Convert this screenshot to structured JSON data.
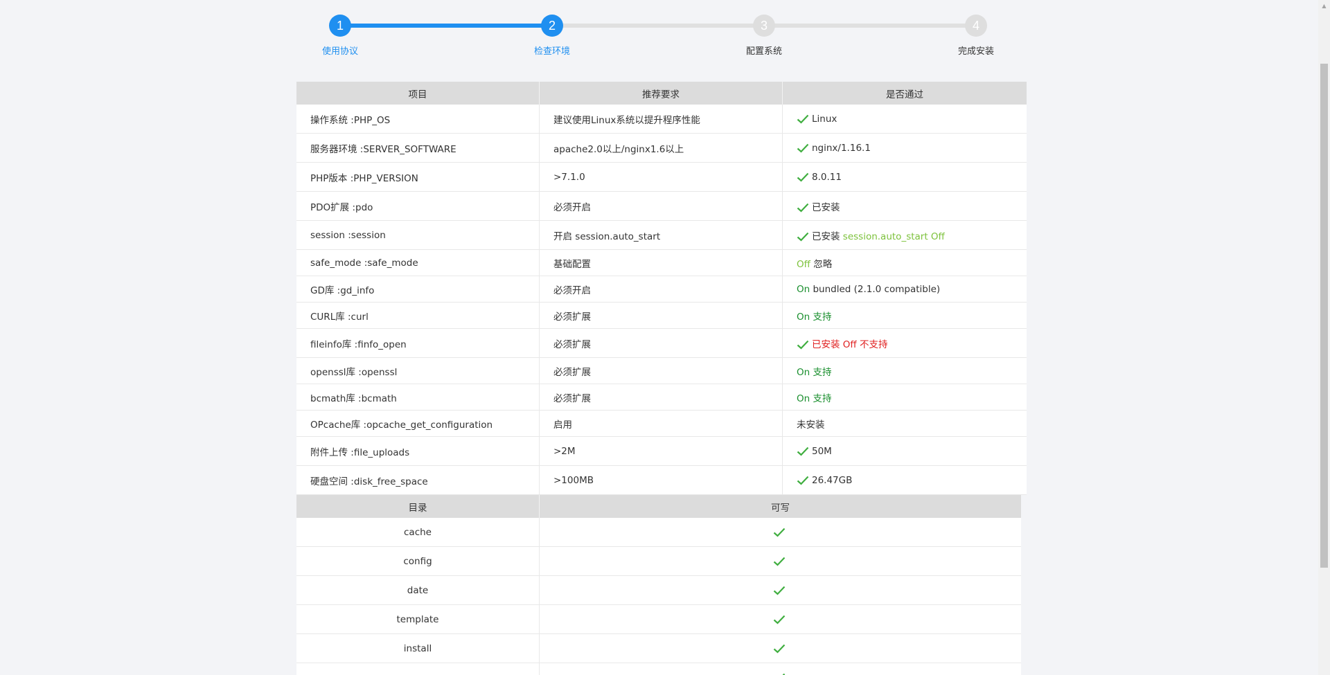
{
  "steps": [
    {
      "number": "1",
      "label": "使用协议",
      "state": "active"
    },
    {
      "number": "2",
      "label": "检查环境",
      "state": "active"
    },
    {
      "number": "3",
      "label": "配置系统",
      "state": "pending"
    },
    {
      "number": "4",
      "label": "完成安装",
      "state": "pending"
    }
  ],
  "env_table": {
    "headers": [
      "项目",
      "推荐要求",
      "是否通过"
    ],
    "rows": [
      {
        "item": "操作系统 :PHP_OS",
        "requirement": "建议使用Linux系统以提升程序性能",
        "check": true,
        "result": "Linux",
        "result_color": "default"
      },
      {
        "item": "服务器环境 :SERVER_SOFTWARE",
        "requirement": "apache2.0以上/nginx1.6以上",
        "check": true,
        "result": "nginx/1.16.1",
        "result_color": "default"
      },
      {
        "item": "PHP版本 :PHP_VERSION",
        "requirement": ">7.1.0",
        "check": true,
        "result": "8.0.11",
        "result_color": "default"
      },
      {
        "item": "PDO扩展 :pdo",
        "requirement": "必须开启",
        "check": true,
        "result": "已安装",
        "result_color": "default"
      },
      {
        "item": "session :session",
        "requirement": "开启 session.auto_start",
        "check": true,
        "result": "已安装",
        "result_extra": "session.auto_start Off",
        "result_color": "default"
      },
      {
        "item": "safe_mode :safe_mode",
        "requirement": "基础配置",
        "check": false,
        "status": "Off",
        "status_color": "#7dc23c",
        "result": "忽略",
        "result_color": "default",
        "short": true
      },
      {
        "item": "GD库 :gd_info",
        "requirement": "必须开启",
        "check": false,
        "status": "On",
        "status_color": "#1a8f2e",
        "result": "bundled (2.1.0 compatible)",
        "result_color": "default",
        "short": true
      },
      {
        "item": "CURL库 :curl",
        "requirement": "必须扩展",
        "check": false,
        "status": "On",
        "status_color": "#1a8f2e",
        "result": "支持",
        "result_color": "green",
        "short": true
      },
      {
        "item": "fileinfo库 :finfo_open",
        "requirement": "必须扩展",
        "check": true,
        "result": "已安装 Off 不支持",
        "result_color": "red"
      },
      {
        "item": "openssl库 :openssl",
        "requirement": "必须扩展",
        "check": false,
        "status": "On",
        "status_color": "#1a8f2e",
        "result": "支持",
        "result_color": "green",
        "short": true
      },
      {
        "item": "bcmath库 :bcmath",
        "requirement": "必须扩展",
        "check": false,
        "status": "On",
        "status_color": "#1a8f2e",
        "result": "支持",
        "result_color": "green",
        "short": true
      },
      {
        "item": "OPcache库 :opcache_get_configuration",
        "requirement": "启用",
        "check": false,
        "result": "未安装",
        "result_color": "default",
        "short": true
      },
      {
        "item": "附件上传 :file_uploads",
        "requirement": ">2M",
        "check": true,
        "result": "50M",
        "result_color": "default"
      },
      {
        "item": "硬盘空间 :disk_free_space",
        "requirement": ">100MB",
        "check": true,
        "result": "26.47GB",
        "result_color": "default"
      }
    ]
  },
  "dir_table": {
    "headers": [
      "目录",
      "可写"
    ],
    "rows": [
      {
        "name": "cache",
        "writable": true
      },
      {
        "name": "config",
        "writable": true
      },
      {
        "name": "date",
        "writable": true
      },
      {
        "name": "template",
        "writable": true
      },
      {
        "name": "install",
        "writable": true
      },
      {
        "name": "",
        "writable": true
      }
    ]
  },
  "colors": {
    "accent": "#1f8ff0",
    "check": "#3fae3f",
    "on": "#1a8f2e",
    "off": "#7dc23c",
    "error": "#e02020"
  },
  "icons": {
    "check": "check-icon"
  }
}
